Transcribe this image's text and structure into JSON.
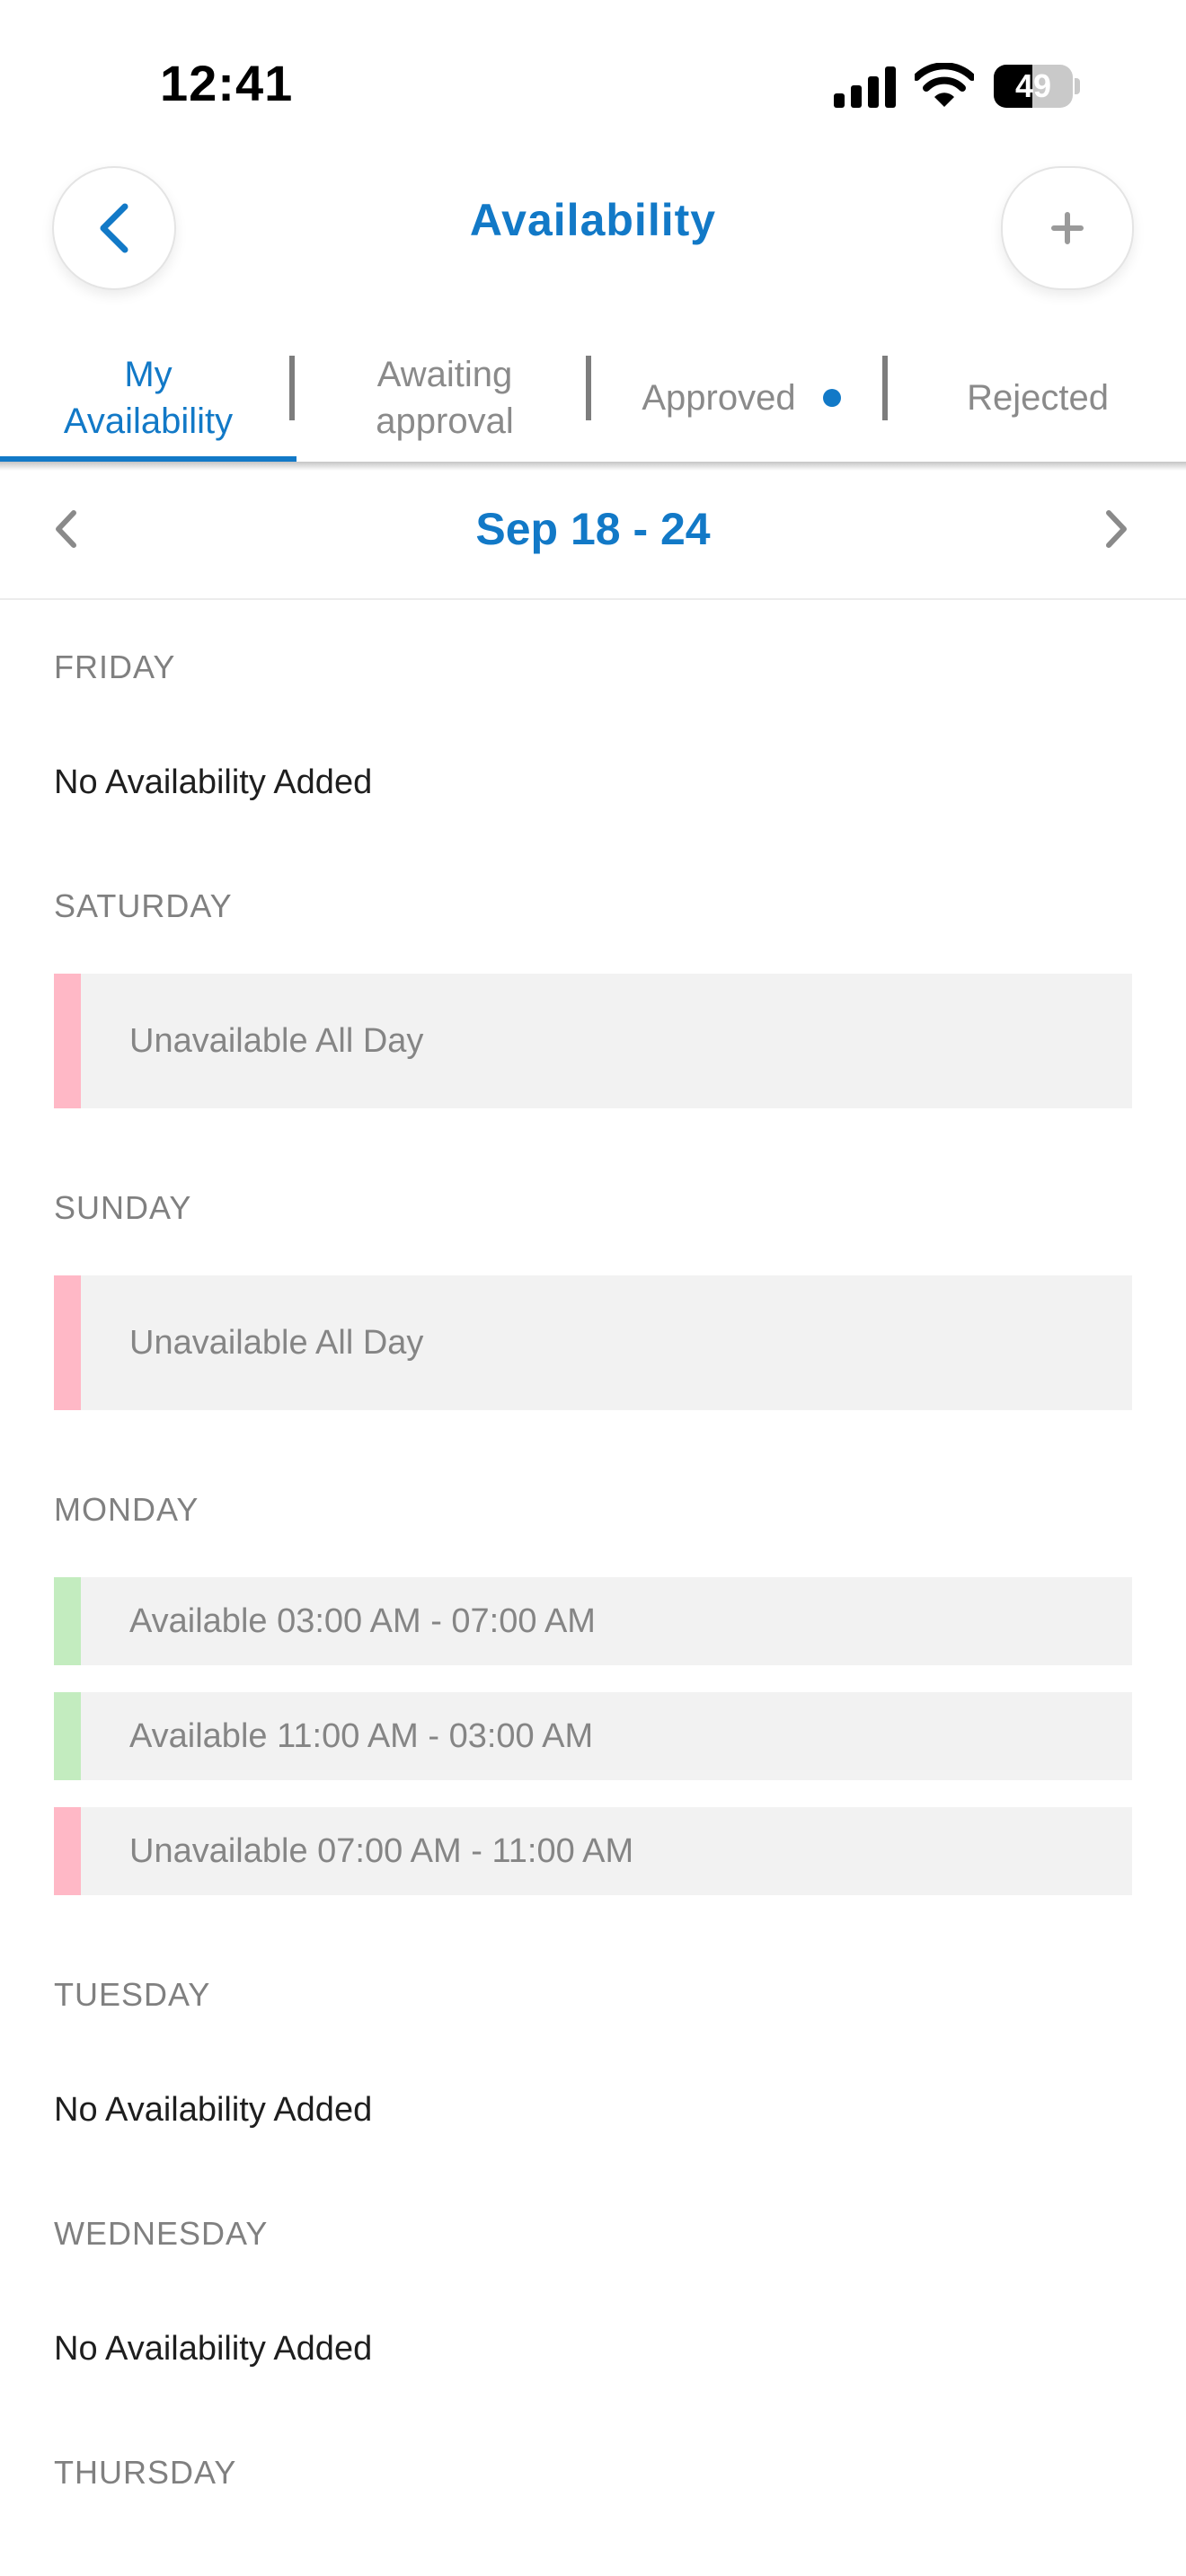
{
  "status_bar": {
    "time": "12:41",
    "battery": "49",
    "battery_level": 0.49
  },
  "header": {
    "title": "Availability",
    "back_icon": "chevron-left-icon",
    "add_icon": "plus-icon"
  },
  "tabs": [
    {
      "line1": "My",
      "line2": "Availability",
      "active": true
    },
    {
      "line1": "Awaiting",
      "line2": "approval",
      "active": false
    },
    {
      "label": "Approved",
      "has_dot": true,
      "active": false
    },
    {
      "label": "Rejected",
      "active": false
    }
  ],
  "week": {
    "label": "Sep 18 - 24"
  },
  "colors": {
    "accent": "#1279c7",
    "available": "#c3ecbf",
    "unavailable": "#ffb8c6"
  },
  "days": [
    {
      "name": "FRIDAY",
      "empty_text": "No Availability Added"
    },
    {
      "name": "SATURDAY",
      "slots": [
        {
          "text": "Unavailable All Day",
          "status": "unavailable"
        }
      ]
    },
    {
      "name": "SUNDAY",
      "slots": [
        {
          "text": "Unavailable All Day",
          "status": "unavailable"
        }
      ]
    },
    {
      "name": "MONDAY",
      "slots": [
        {
          "text": "Available 03:00 AM - 07:00 AM",
          "status": "available"
        },
        {
          "text": "Available 11:00 AM - 03:00 AM",
          "status": "available"
        },
        {
          "text": "Unavailable 07:00 AM - 11:00 AM",
          "status": "unavailable"
        }
      ]
    },
    {
      "name": "TUESDAY",
      "empty_text": "No Availability Added"
    },
    {
      "name": "WEDNESDAY",
      "empty_text": "No Availability Added"
    },
    {
      "name": "THURSDAY"
    }
  ]
}
